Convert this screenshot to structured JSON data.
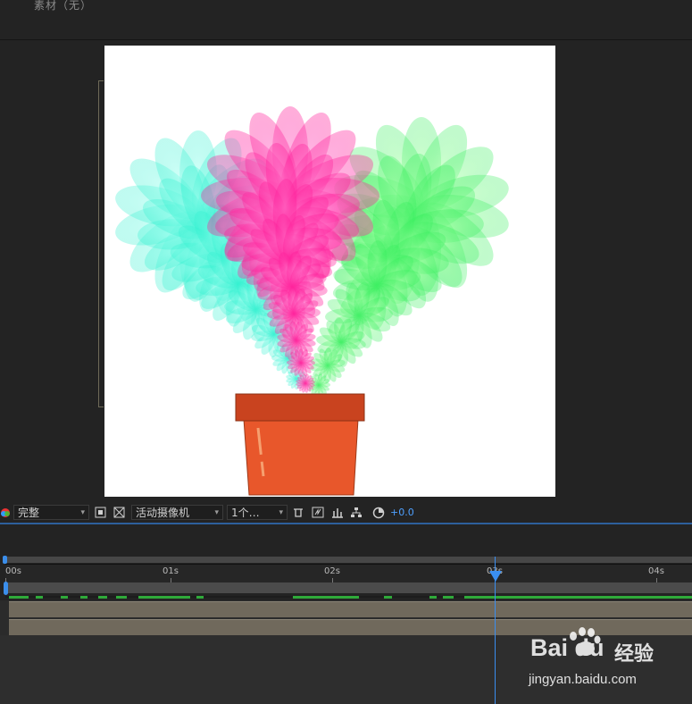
{
  "panel": {
    "title": "素材（无）"
  },
  "toolbar": {
    "resolution": "完整",
    "camera": "活动摄像机",
    "views": "1个…",
    "exposure": "+0.0",
    "icons": [
      "color-wheel-icon",
      "region-of-interest-icon",
      "transparency-grid-icon",
      "3d-draft-icon",
      "fast-preview-icon",
      "timeline-icon",
      "flowchart-icon",
      "reset-exposure-icon"
    ]
  },
  "timeline": {
    "ticks": [
      "00s",
      "01s",
      "02s",
      "03s",
      "04s"
    ],
    "current_time_label": "03s",
    "cache_color": "#2faa3a",
    "playhead_color": "#3a8ef0",
    "layer_color": "#70695c"
  },
  "canvas": {
    "background": "#ffffff",
    "pot_color": "#e8572b",
    "rim_color": "#c9431f",
    "flower_colors": [
      "#3ff5d2",
      "#ff2fa5",
      "#48f06a"
    ]
  },
  "watermark": {
    "logo": "Bai du",
    "brand": "经验",
    "url": "jingyan.baidu.com"
  }
}
